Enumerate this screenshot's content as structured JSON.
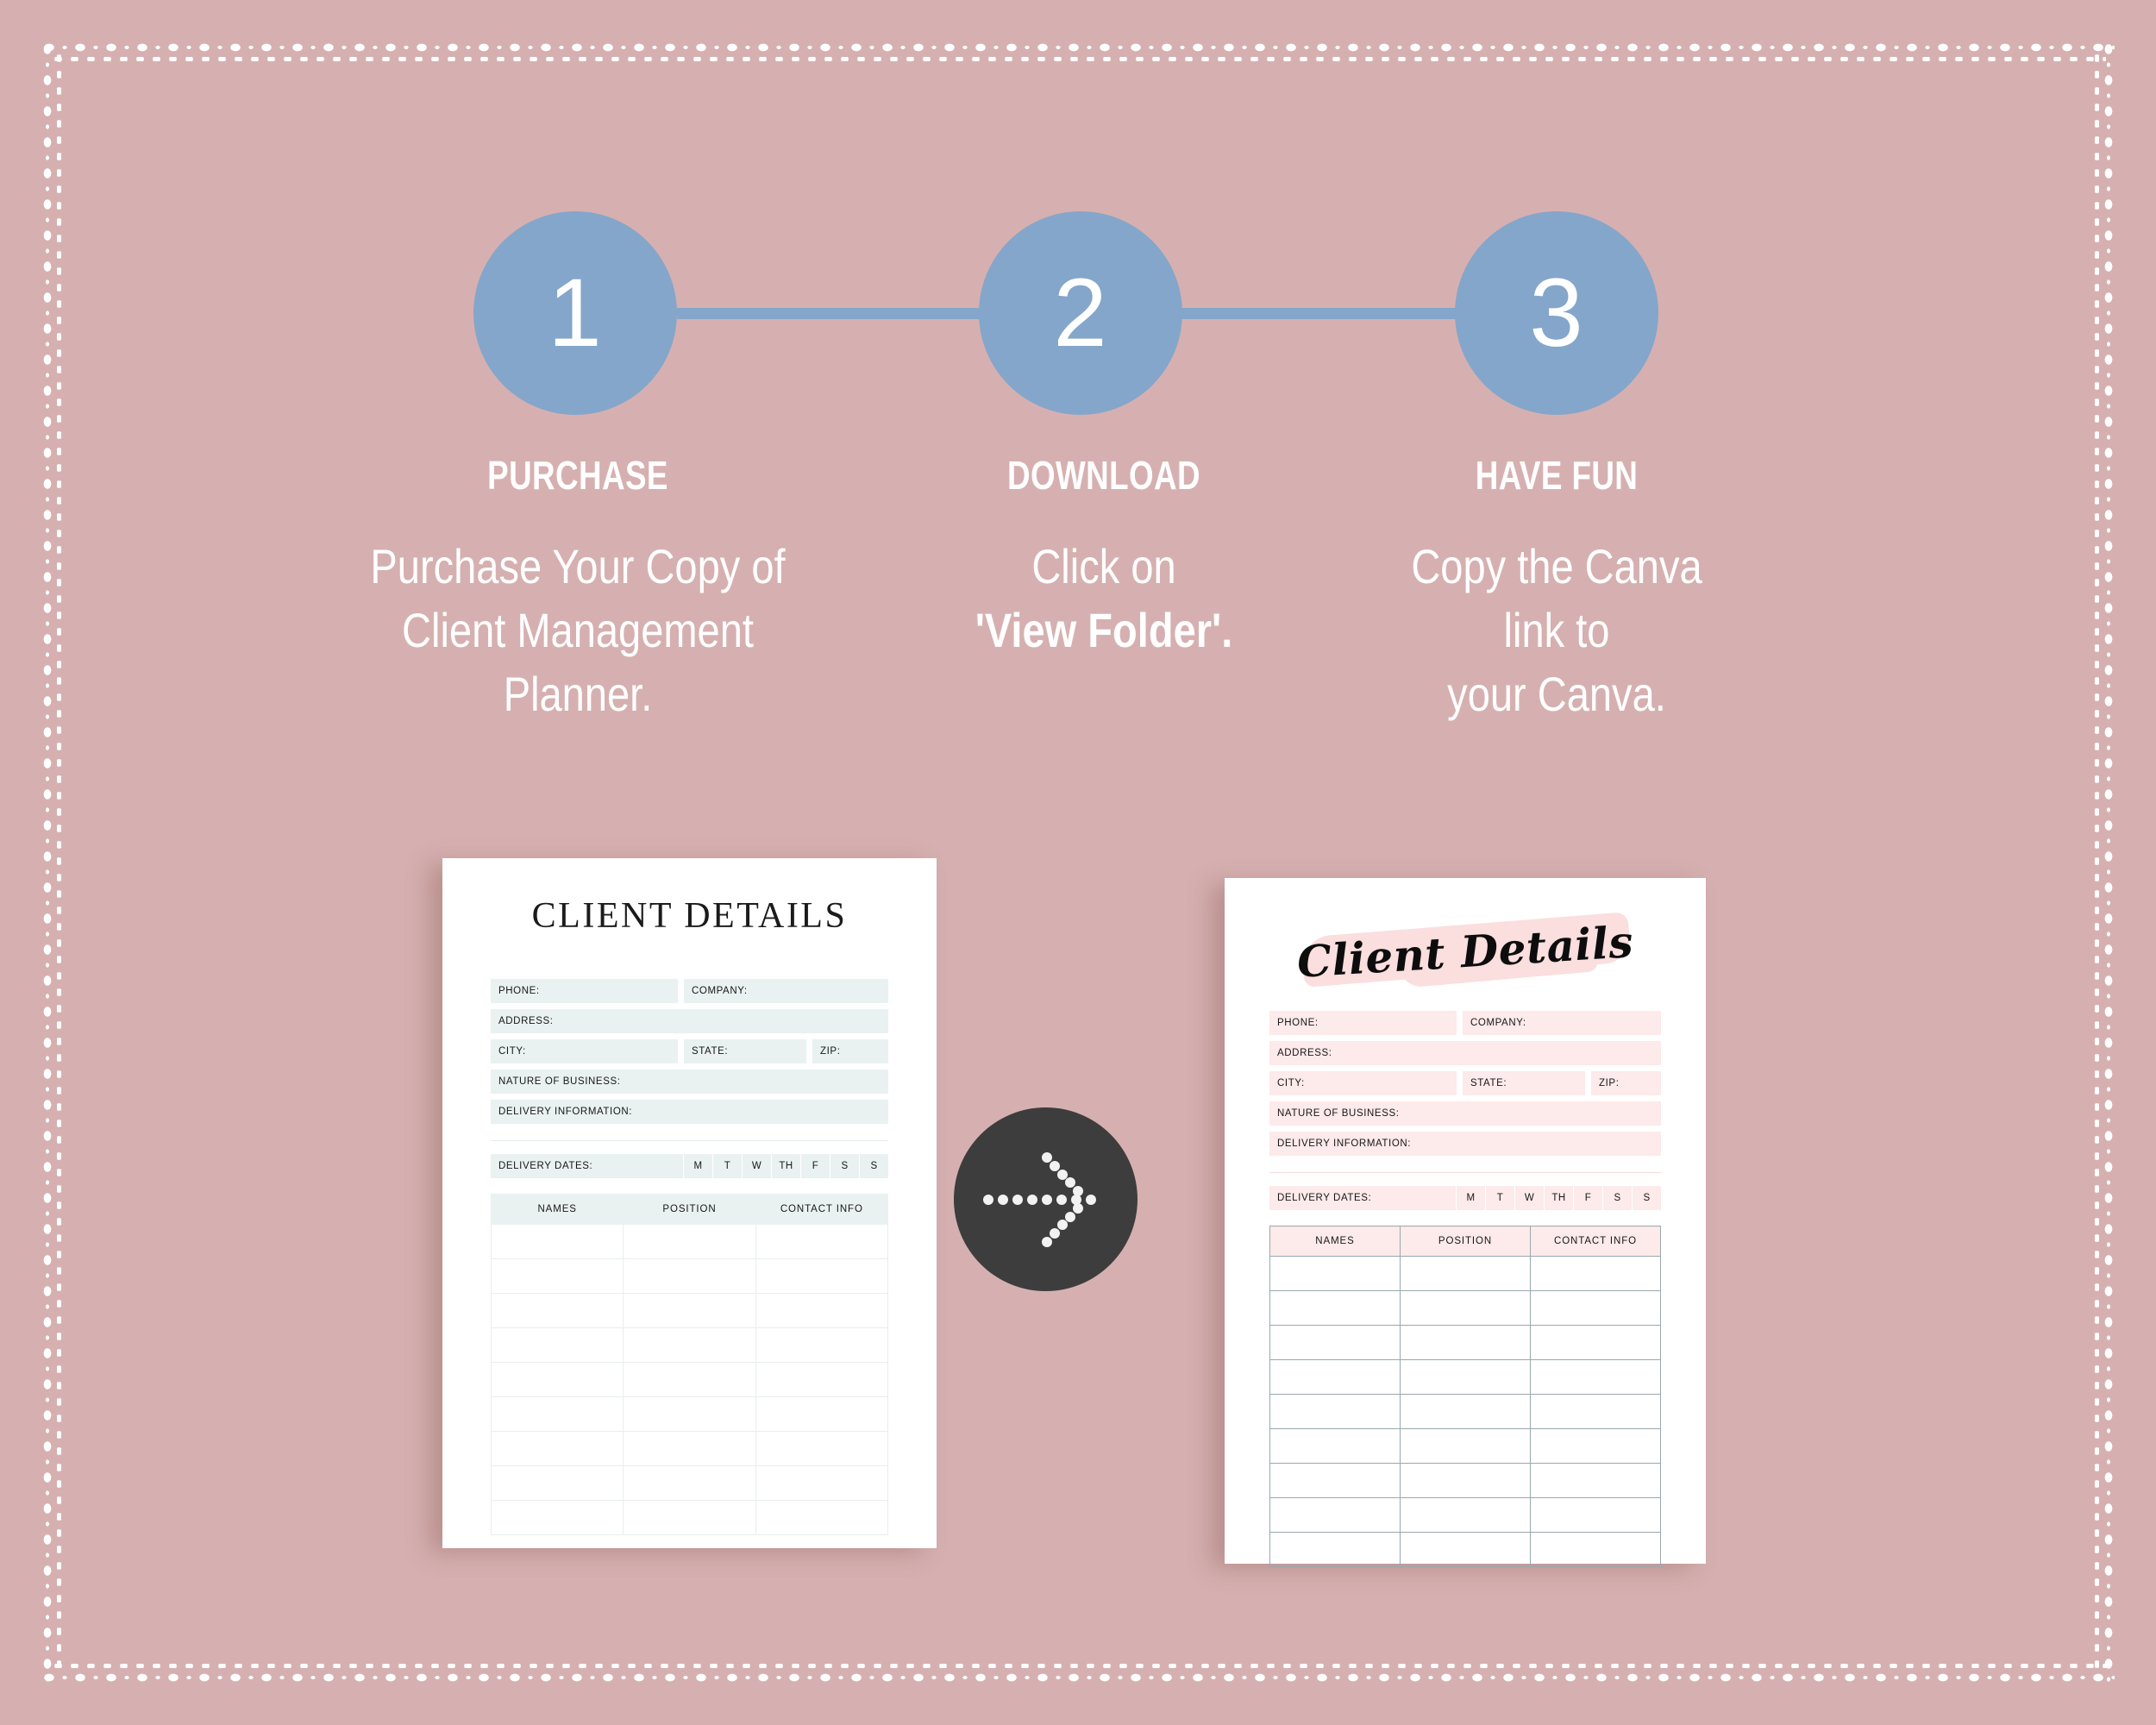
{
  "theme": {
    "background": "#d6b0b0",
    "accent_blue": "#84a6ca",
    "text_white": "#ffffff",
    "badge_dark": "#3d3d3d",
    "left_doc_field": "#eaf1f1",
    "right_doc_field": "#fdeaea",
    "brush_pink": "#fbdede"
  },
  "steps": [
    {
      "number": "1",
      "title": "PURCHASE",
      "lines": [
        "Purchase Your Copy of",
        "Client Management",
        "Planner."
      ]
    },
    {
      "number": "2",
      "title": "DOWNLOAD",
      "lines": [
        "Click  on",
        "'View Folder'."
      ]
    },
    {
      "number": "3",
      "title": "HAVE FUN",
      "lines": [
        "Copy the Canva",
        "link to",
        "your Canva."
      ]
    }
  ],
  "documents": {
    "left": {
      "title": "CLIENT DETAILS",
      "fields": {
        "phone": "PHONE:",
        "company": "COMPANY:",
        "address": "ADDRESS:",
        "city": "CITY:",
        "state": "STATE:",
        "zip": "ZIP:",
        "nature_of_business": "NATURE OF BUSINESS:",
        "delivery_information": "DELIVERY INFORMATION:",
        "delivery_dates": "DELIVERY DATES:"
      },
      "days": [
        "M",
        "T",
        "W",
        "TH",
        "F",
        "S",
        "S"
      ],
      "table_headers": [
        "NAMES",
        "POSITION",
        "CONTACT INFO"
      ],
      "table_row_count": 9
    },
    "right": {
      "title": "Client Details",
      "fields": {
        "phone": "PHONE:",
        "company": "COMPANY:",
        "address": "ADDRESS:",
        "city": "CITY:",
        "state": "STATE:",
        "zip": "ZIP:",
        "nature_of_business": "NATURE OF BUSINESS:",
        "delivery_information": "DELIVERY INFORMATION:",
        "delivery_dates": "DELIVERY DATES:"
      },
      "days": [
        "M",
        "T",
        "W",
        "TH",
        "F",
        "S",
        "S"
      ],
      "table_headers": [
        "NAMES",
        "POSITION",
        "CONTACT INFO"
      ],
      "table_row_count": 9
    }
  },
  "arrow_badge": {
    "icon": "dotted-arrow-right-icon"
  }
}
